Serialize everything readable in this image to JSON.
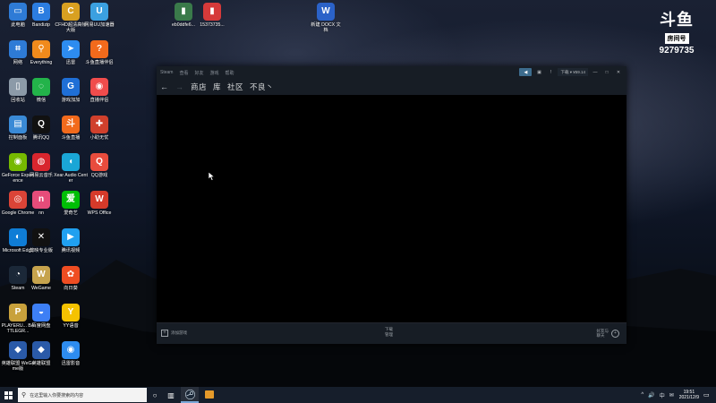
{
  "desktop": {
    "icons": [
      {
        "label": "此电脑",
        "color": "#2e7bd6",
        "glyph": "▭"
      },
      {
        "label": "网络",
        "color": "#2e7bd6",
        "glyph": "⌗"
      },
      {
        "label": "回收站",
        "color": "#8c9aa8",
        "glyph": "▯"
      },
      {
        "label": "控制面板",
        "color": "#3a8ad6",
        "glyph": "▤"
      },
      {
        "label": "GeForce Experience",
        "color": "#76b900",
        "glyph": "◉"
      },
      {
        "label": "Google Chrome",
        "color": "#db4437",
        "glyph": "◎"
      },
      {
        "label": "Microsoft Edge",
        "color": "#0f7dd6",
        "glyph": "◐"
      },
      {
        "label": "Steam",
        "color": "#1b2838",
        "glyph": "◔"
      },
      {
        "label": "PLAYERU... BATTLEGR...",
        "color": "#c8a13c",
        "glyph": "P"
      },
      {
        "label": "英雄联盟 WeGame版",
        "color": "#2a5aa8",
        "glyph": "◆"
      },
      {
        "label": "Bandizip",
        "color": "#2c7de0",
        "glyph": "B"
      },
      {
        "label": "Everything",
        "color": "#f08a1c",
        "glyph": "⚲"
      },
      {
        "label": "微信",
        "color": "#23b34a",
        "glyph": "◌"
      },
      {
        "label": "腾讯QQ",
        "color": "#111111",
        "glyph": "Q"
      },
      {
        "label": "网易云音乐",
        "color": "#d8262e",
        "glyph": "◍"
      },
      {
        "label": "nn",
        "color": "#e64c7a",
        "glyph": "n"
      },
      {
        "label": "剪映专业版",
        "color": "#111111",
        "glyph": "✕"
      },
      {
        "label": "WeGame",
        "color": "#c6a34d",
        "glyph": "W"
      },
      {
        "label": "百度网盘",
        "color": "#3d7ff5",
        "glyph": "◒"
      },
      {
        "label": "英雄联盟",
        "color": "#2a5aa8",
        "glyph": "◆"
      },
      {
        "label": "CFHD超清高帧大版",
        "color": "#d8a021",
        "glyph": "C"
      },
      {
        "label": "迅雷",
        "color": "#2d8cf0",
        "glyph": "➤"
      },
      {
        "label": "游戏加加",
        "color": "#1f6fd6",
        "glyph": "G"
      },
      {
        "label": "斗鱼直播",
        "color": "#f26a1c",
        "glyph": "斗"
      },
      {
        "label": "Xear Audio Center",
        "color": "#1aa6d6",
        "glyph": "◖"
      },
      {
        "label": "爱奇艺",
        "color": "#00be06",
        "glyph": "爱"
      },
      {
        "label": "腾讯视频",
        "color": "#20a0f0",
        "glyph": "▶"
      },
      {
        "label": "向日葵",
        "color": "#ef4d22",
        "glyph": "✿"
      },
      {
        "label": "YY语音",
        "color": "#f5c200",
        "glyph": "Y"
      },
      {
        "label": "迅雷影音",
        "color": "#2d8cf0",
        "glyph": "◉"
      },
      {
        "label": "网易UU加速器",
        "color": "#3ba0e0",
        "glyph": "U"
      },
      {
        "label": "斗鱼直播伴侣",
        "color": "#f26a1c",
        "glyph": "?"
      },
      {
        "label": "直播伴侣",
        "color": "#f04c4c",
        "glyph": "◉"
      },
      {
        "label": "小助无忧",
        "color": "#d0402c",
        "glyph": "✚"
      },
      {
        "label": "QQ游戏",
        "color": "#e84c3d",
        "glyph": "Q"
      },
      {
        "label": "WPS Office",
        "color": "#d63a2a",
        "glyph": "W"
      },
      {
        "label": "eb0ddfe6...",
        "color": "#3a7a4a",
        "glyph": "▮"
      },
      {
        "label": "15373735...",
        "color": "#d63a3a",
        "glyph": "▮"
      },
      {
        "label": "新建 DOCX 文档",
        "color": "#2b62c8",
        "glyph": "W"
      }
    ]
  },
  "watermark": {
    "logo": "斗鱼",
    "room_label": "房间号",
    "room_number": "9279735"
  },
  "steam": {
    "menu": [
      "Steam",
      "查看",
      "好友",
      "游戏",
      "帮助"
    ],
    "title_controls": {
      "user": "下载 ▾ ¥59.14",
      "minimize": "—",
      "maximize": "□",
      "close": "✕"
    },
    "nav": {
      "back": "←",
      "forward": "→",
      "store": "商店",
      "library": "库",
      "community": "社区",
      "profile": "不良丶"
    },
    "footer": {
      "add_game_plus": "+",
      "add_game": "添加游戏",
      "downloads_title": "下载",
      "downloads_sub": "管理",
      "friends_line1": "好友与",
      "friends_line2": "聊天",
      "friends_plus": "+"
    }
  },
  "taskbar": {
    "search_placeholder": "在这里输入你要搜索的内容",
    "time": "19:51",
    "date": "2021/12/9",
    "tray": [
      "^",
      "🔊",
      "中",
      "✉"
    ]
  }
}
